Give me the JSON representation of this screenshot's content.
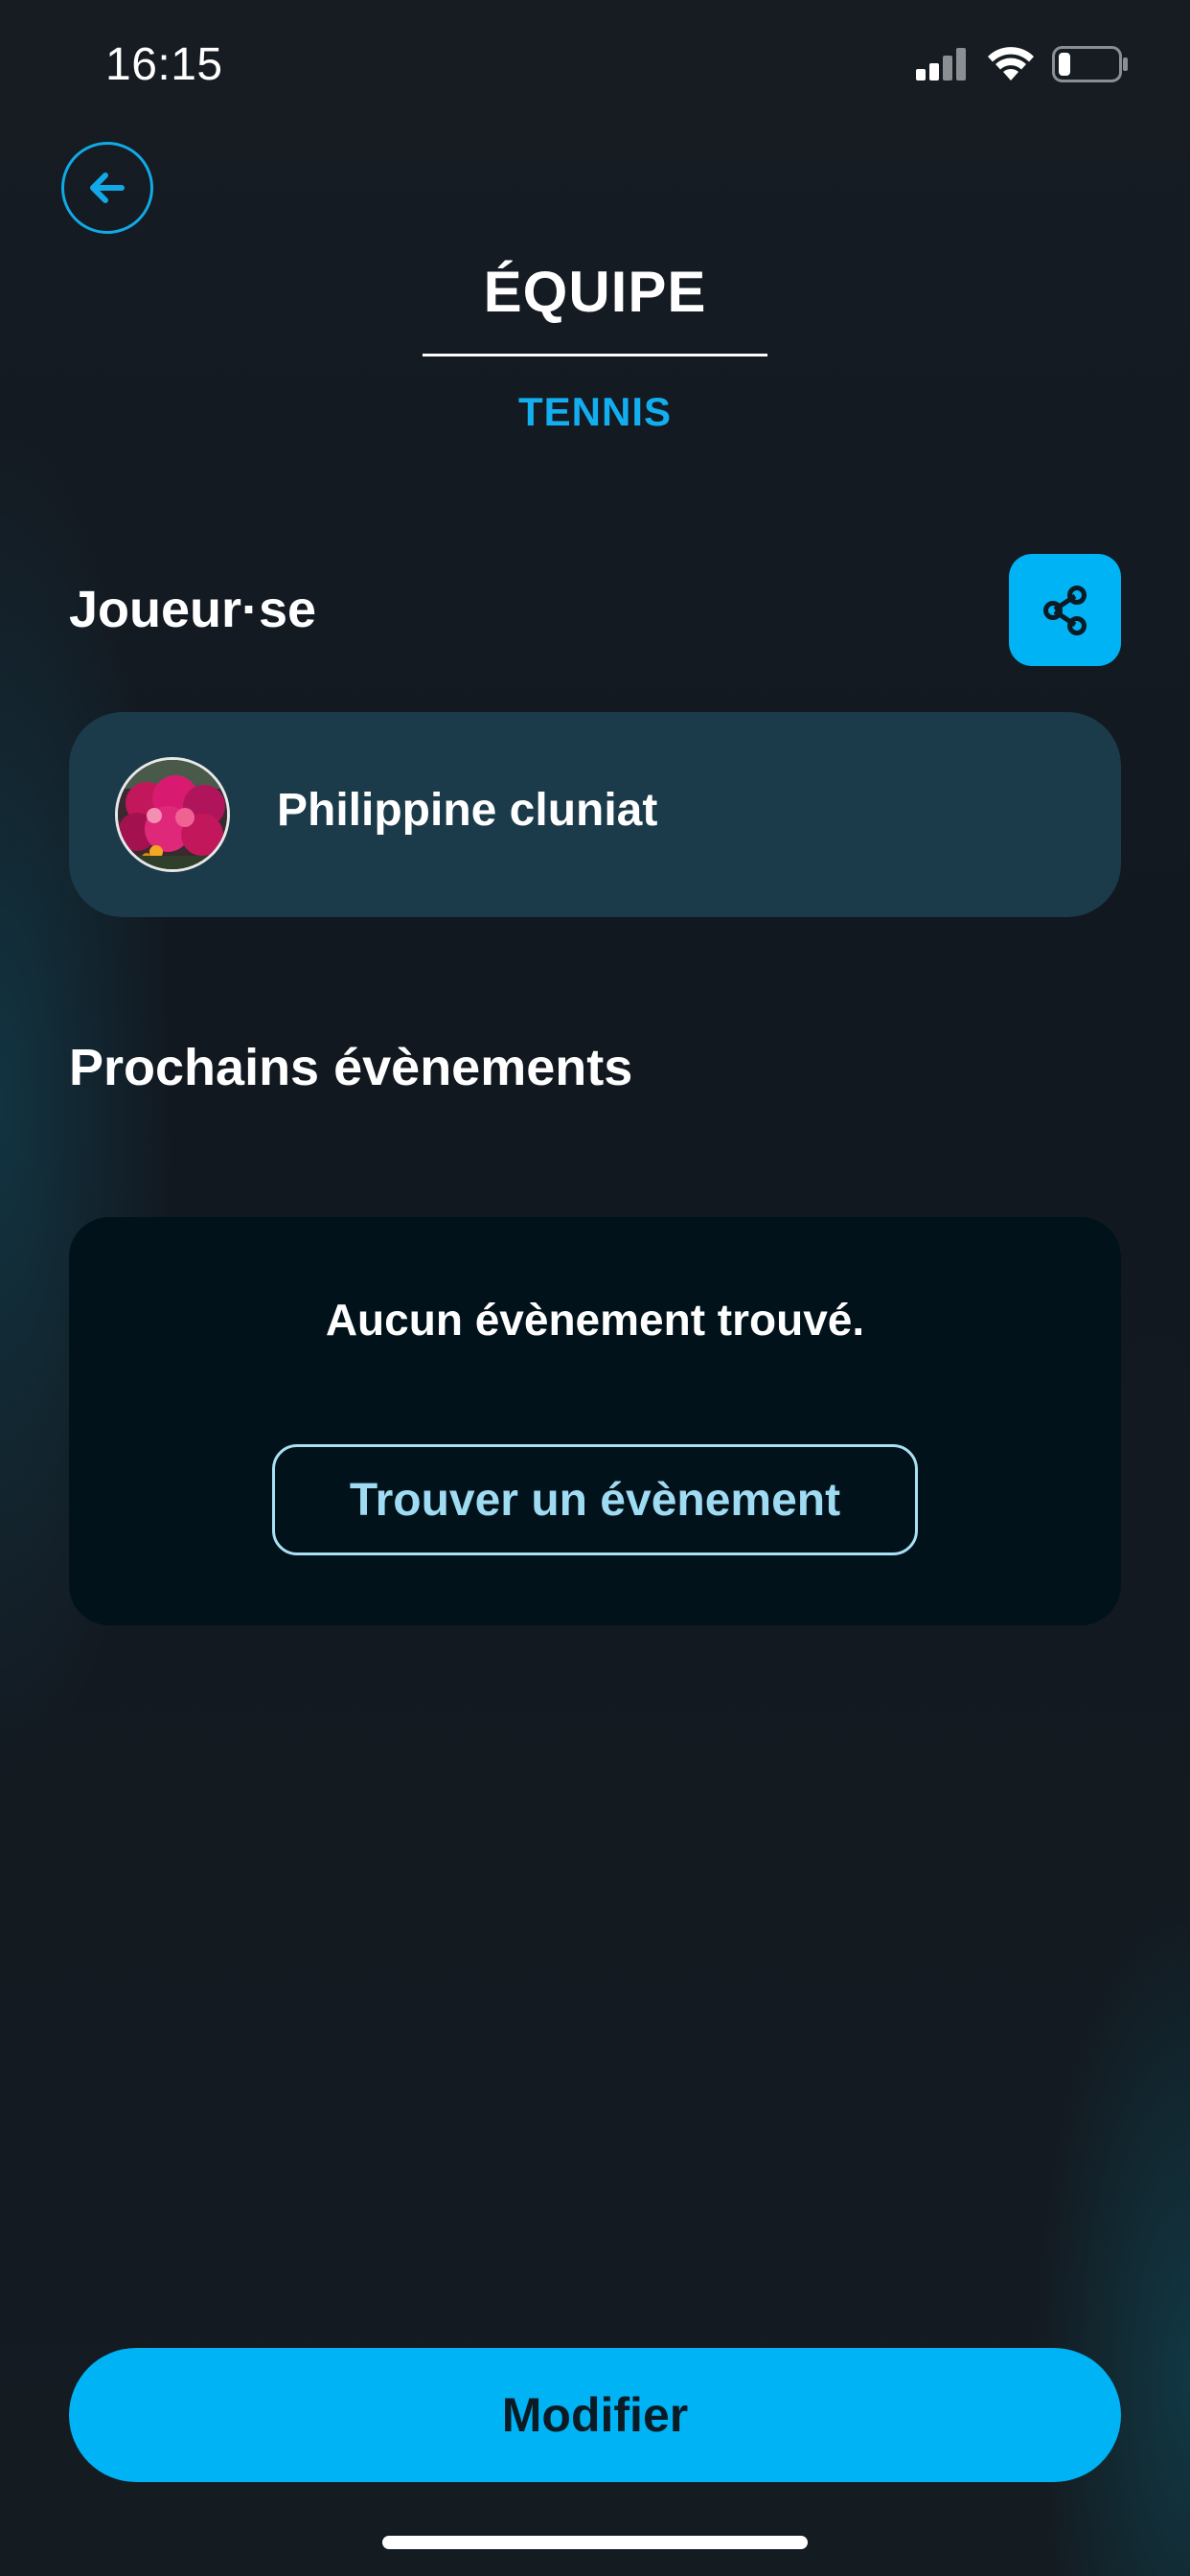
{
  "status_bar": {
    "time": "16:15"
  },
  "header": {
    "title": "ÉQUIPE",
    "subtitle": "TENNIS"
  },
  "players_section": {
    "heading": "Joueur·se",
    "players": [
      {
        "name": "Philippine cluniat"
      }
    ]
  },
  "events_section": {
    "heading": "Prochains évènements",
    "empty_message": "Aucun évènement trouvé.",
    "find_button_label": "Trouver un évènement"
  },
  "footer": {
    "modify_button_label": "Modifier"
  },
  "icons": {
    "back": "arrow-left-icon",
    "share": "share-icon"
  },
  "colors": {
    "accent": "#00b3f5",
    "card": "#1b3a4a",
    "events_card": "#01121a"
  }
}
